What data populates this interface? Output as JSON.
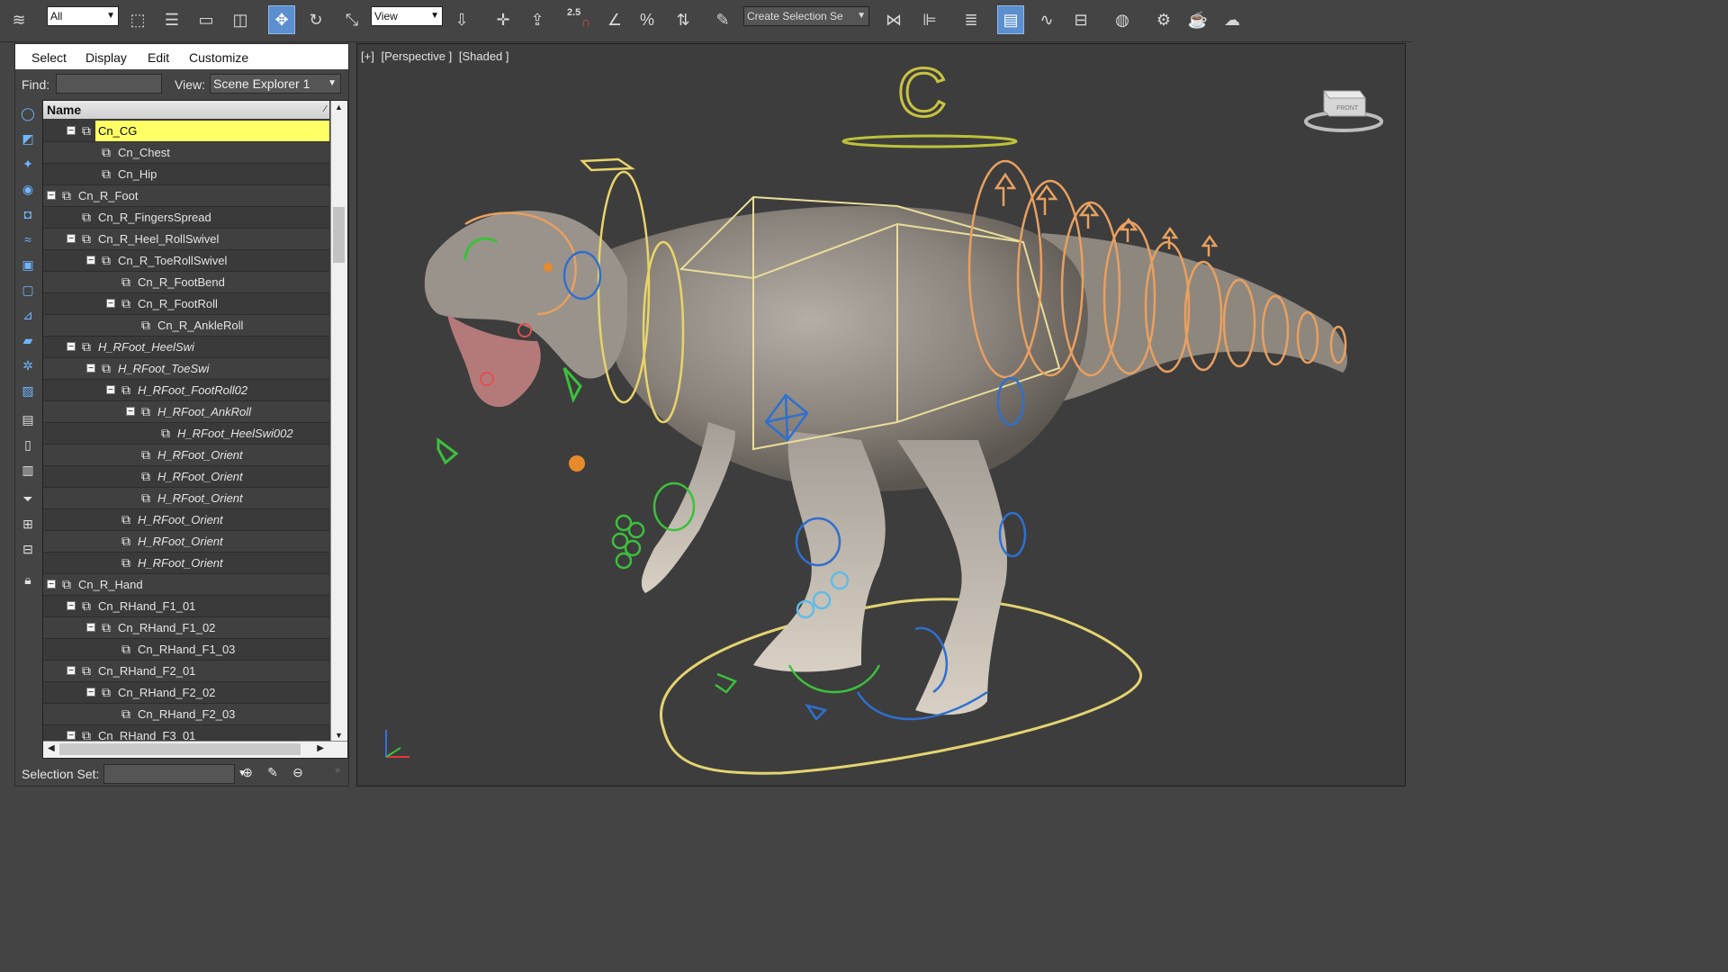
{
  "toolbar": {
    "selection_filter": "All",
    "reference_coord": "View",
    "snap_value": "2.5",
    "named_selection_placeholder": "Create Selection Se"
  },
  "explorer": {
    "menu": [
      "Select",
      "Display",
      "Edit",
      "Customize"
    ],
    "find_label": "Find:",
    "find_value": "",
    "view_label": "View:",
    "view_value": "Scene Explorer 1",
    "column_header": "Name",
    "selection_set_label": "Selection Set:",
    "selection_set_value": "",
    "rows": [
      {
        "name": "Cn_CG",
        "depth": 1,
        "expander": "−",
        "italic": false,
        "selected": true
      },
      {
        "name": "Cn_Chest",
        "depth": 2,
        "expander": "",
        "italic": false,
        "selected": false
      },
      {
        "name": "Cn_Hip",
        "depth": 2,
        "expander": "",
        "italic": false,
        "selected": false
      },
      {
        "name": "Cn_R_Foot",
        "depth": 0,
        "expander": "−",
        "italic": false,
        "selected": false
      },
      {
        "name": "Cn_R_FingersSpread",
        "depth": 1,
        "expander": "",
        "italic": false,
        "selected": false
      },
      {
        "name": "Cn_R_Heel_RollSwivel",
        "depth": 1,
        "expander": "−",
        "italic": false,
        "selected": false
      },
      {
        "name": "Cn_R_ToeRollSwivel",
        "depth": 2,
        "expander": "−",
        "italic": false,
        "selected": false
      },
      {
        "name": "Cn_R_FootBend",
        "depth": 3,
        "expander": "",
        "italic": false,
        "selected": false
      },
      {
        "name": "Cn_R_FootRoll",
        "depth": 3,
        "expander": "−",
        "italic": false,
        "selected": false
      },
      {
        "name": "Cn_R_AnkleRoll",
        "depth": 4,
        "expander": "",
        "italic": false,
        "selected": false
      },
      {
        "name": "H_RFoot_HeelSwi",
        "depth": 1,
        "expander": "−",
        "italic": true,
        "selected": false
      },
      {
        "name": "H_RFoot_ToeSwi",
        "depth": 2,
        "expander": "−",
        "italic": true,
        "selected": false
      },
      {
        "name": "H_RFoot_FootRoll02",
        "depth": 3,
        "expander": "−",
        "italic": true,
        "selected": false
      },
      {
        "name": "H_RFoot_AnkRoll",
        "depth": 4,
        "expander": "−",
        "italic": true,
        "selected": false
      },
      {
        "name": "H_RFoot_HeelSwi002",
        "depth": 5,
        "expander": "",
        "italic": true,
        "selected": false
      },
      {
        "name": "H_RFoot_Orient",
        "depth": 4,
        "expander": "",
        "italic": true,
        "selected": false
      },
      {
        "name": "H_RFoot_Orient",
        "depth": 4,
        "expander": "",
        "italic": true,
        "selected": false
      },
      {
        "name": "H_RFoot_Orient",
        "depth": 4,
        "expander": "",
        "italic": true,
        "selected": false
      },
      {
        "name": "H_RFoot_Orient",
        "depth": 3,
        "expander": "",
        "italic": true,
        "selected": false
      },
      {
        "name": "H_RFoot_Orient",
        "depth": 3,
        "expander": "",
        "italic": true,
        "selected": false
      },
      {
        "name": "H_RFoot_Orient",
        "depth": 3,
        "expander": "",
        "italic": true,
        "selected": false
      },
      {
        "name": "Cn_R_Hand",
        "depth": 0,
        "expander": "−",
        "italic": false,
        "selected": false
      },
      {
        "name": "Cn_RHand_F1_01",
        "depth": 1,
        "expander": "−",
        "italic": false,
        "selected": false
      },
      {
        "name": "Cn_RHand_F1_02",
        "depth": 2,
        "expander": "−",
        "italic": false,
        "selected": false
      },
      {
        "name": "Cn_RHand_F1_03",
        "depth": 3,
        "expander": "",
        "italic": false,
        "selected": false
      },
      {
        "name": "Cn_RHand_F2_01",
        "depth": 1,
        "expander": "−",
        "italic": false,
        "selected": false
      },
      {
        "name": "Cn_RHand_F2_02",
        "depth": 2,
        "expander": "−",
        "italic": false,
        "selected": false
      },
      {
        "name": "Cn_RHand_F2_03",
        "depth": 3,
        "expander": "",
        "italic": false,
        "selected": false
      },
      {
        "name": "Cn_RHand_F3_01",
        "depth": 1,
        "expander": "−",
        "italic": false,
        "selected": false
      }
    ]
  },
  "viewport": {
    "labels": [
      "[+]",
      "[Perspective ]",
      "[Shaded ]"
    ],
    "viewcube_face": "FRONT"
  },
  "colors": {
    "selected_row": "#ffff66",
    "active_tool": "#5b8fcf",
    "rig_yellow": "#e8d46a",
    "rig_orange": "#e8a060",
    "rig_green": "#3cc03c",
    "rig_blue": "#2f6fd0"
  }
}
